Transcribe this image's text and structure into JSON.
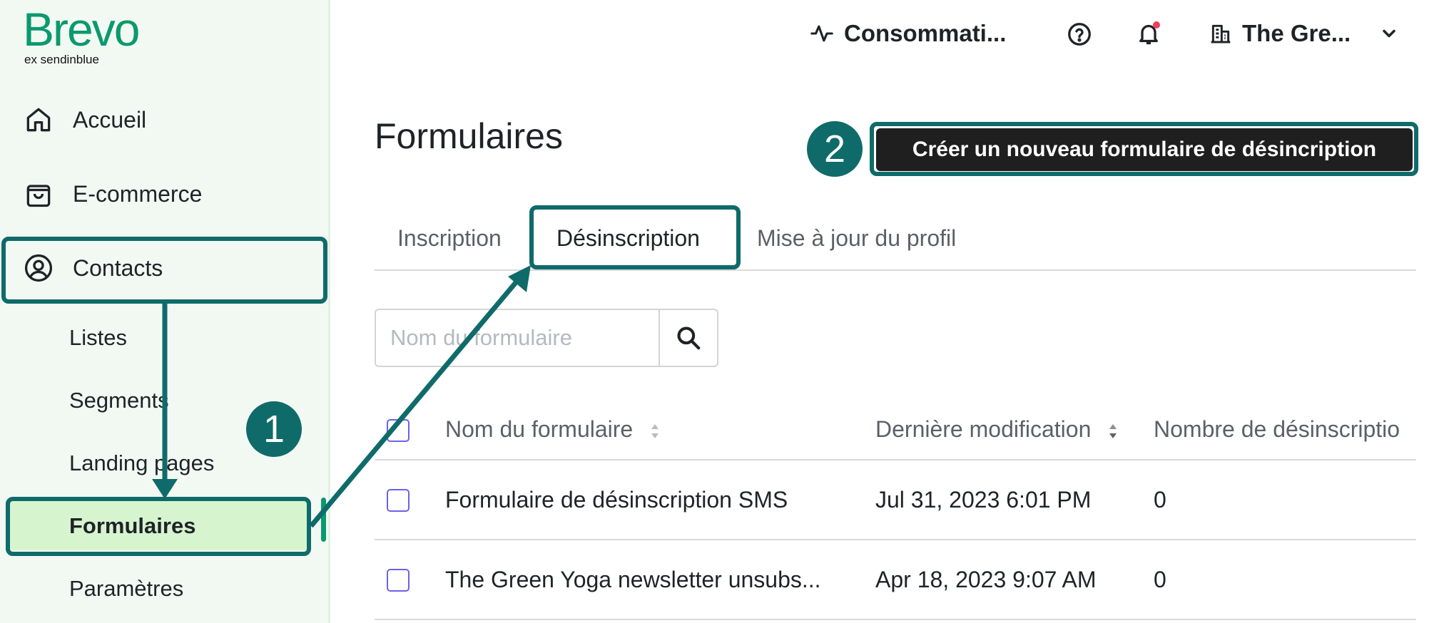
{
  "brand": {
    "name": "Brevo",
    "subtitle": "ex sendinblue",
    "color": "#0b996e"
  },
  "sidebar": {
    "items": [
      {
        "label": "Accueil",
        "icon": "home-icon"
      },
      {
        "label": "E-commerce",
        "icon": "shopping-bag-icon"
      },
      {
        "label": "Contacts",
        "icon": "user-circle-icon"
      }
    ],
    "subitems": [
      "Listes",
      "Segments",
      "Landing pages",
      "Formulaires",
      "Paramètres"
    ],
    "active": "Formulaires"
  },
  "topbar": {
    "usage_label": "Consommati...",
    "usage_icon": "activity-icon",
    "help_icon": "help-circle-icon",
    "bell_icon": "bell-icon",
    "account_label": "The Gre...",
    "account_icon": "building-icon"
  },
  "page": {
    "title": "Formulaires",
    "cta_label": "Créer un nouveau formulaire de désincription"
  },
  "tabs": [
    "Inscription",
    "Désinscription",
    "Mise à jour du profil"
  ],
  "active_tab": "Désinscription",
  "search": {
    "placeholder": "Nom du formulaire",
    "value": ""
  },
  "table": {
    "headers": [
      "Nom du formulaire",
      "Dernière modification",
      "Nombre de désinscriptio"
    ],
    "rows": [
      {
        "name": "Formulaire de désinscription SMS",
        "modified": "Jul 31, 2023 6:01 PM",
        "count": "0"
      },
      {
        "name": "The Green Yoga newsletter unsubs...",
        "modified": "Apr 18, 2023 9:07 AM",
        "count": "0"
      }
    ]
  },
  "annotations": {
    "step1": "1",
    "step2": "2",
    "color": "#0f6b6a"
  }
}
